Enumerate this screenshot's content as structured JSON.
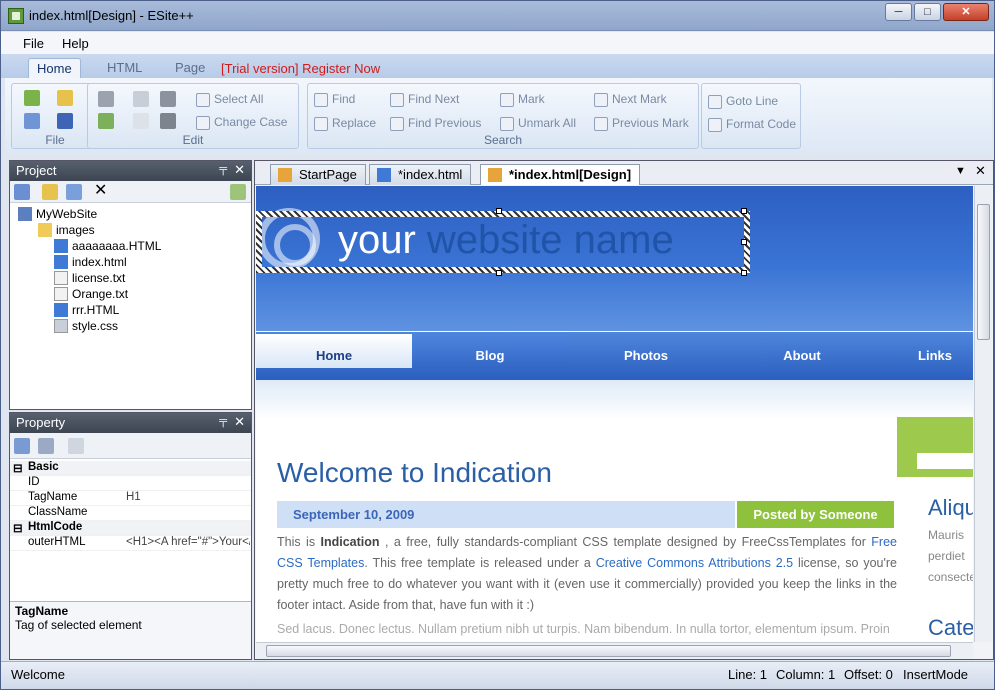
{
  "window": {
    "title": "index.html[Design] - ESite++",
    "min": "─",
    "max": "□",
    "close": "✕"
  },
  "menu": [
    "File",
    "Help"
  ],
  "ribbon_tabs": [
    "Home",
    "HTML",
    "Page"
  ],
  "trial_text": "[Trial version] Register Now",
  "ribbon": {
    "file_group": "File",
    "edit_group": "Edit",
    "search_group": "Search",
    "select_all": "Select All",
    "change_case": "Change Case",
    "find": "Find",
    "replace": "Replace",
    "find_next": "Find Next",
    "find_previous": "Find Previous",
    "mark": "Mark",
    "unmark_all": "Unmark All",
    "next_mark": "Next Mark",
    "previous_mark": "Previous Mark",
    "goto_line": "Goto Line",
    "format_code": "Format Code"
  },
  "project": {
    "title": "Project",
    "pin": "╤",
    "close": "✕",
    "root": "MyWebSite",
    "items": [
      "images",
      "aaaaaaaa.HTML",
      "index.html",
      "license.txt",
      "Orange.txt",
      "rrr.HTML",
      "style.css"
    ]
  },
  "property": {
    "title": "Property",
    "pin": "╤",
    "close": "✕",
    "basic": "Basic",
    "id": "ID",
    "tagname": "TagName",
    "tagname_val": "H1",
    "classname": "ClassName",
    "htmlcode": "HtmlCode",
    "outerhtml": "outerHTML",
    "outerhtml_val": "<H1><A href=\"#\">Your</",
    "desc_title": "TagName",
    "desc_text": "Tag of selected element"
  },
  "doc_tabs": [
    "StartPage",
    "*index.html",
    "*index.html[Design]"
  ],
  "site": {
    "name_a": "your",
    "name_b": " website name",
    "nav": [
      "Home",
      "Blog",
      "Photos",
      "About",
      "Links"
    ],
    "heading": "Welcome to Indication",
    "date": "September 10, 2009",
    "posted_by": "Posted by Someone",
    "p_this_is": "This is ",
    "p_indication": "Indication",
    "p_mid1": " , a free, fully standards-compliant CSS template designed by FreeCssTemplates for ",
    "p_link1": "Free CSS Templates",
    "p_mid2": ". This free template is released under a ",
    "p_link2": "Creative Commons Attributions 2.5",
    "p_end": " license, so you're pretty much free to do whatever you want with it (even use it commercially) provided you keep the links in the footer intact. Aside from that, have fun with it :)",
    "p2": "Sed lacus. Donec lectus. Nullam pretium nibh ut turpis. Nam bibendum. In nulla tortor, elementum ipsum. Proin",
    "side_title": "Aliqu",
    "side_l1": "Mauris",
    "side_l2": "perdiet",
    "side_l3": "consecte",
    "side_title2": "Cate"
  },
  "status": {
    "left": "Welcome",
    "line": "Line: 1",
    "column": "Column: 1",
    "offset": "Offset: 0",
    "mode": "InsertMode"
  }
}
